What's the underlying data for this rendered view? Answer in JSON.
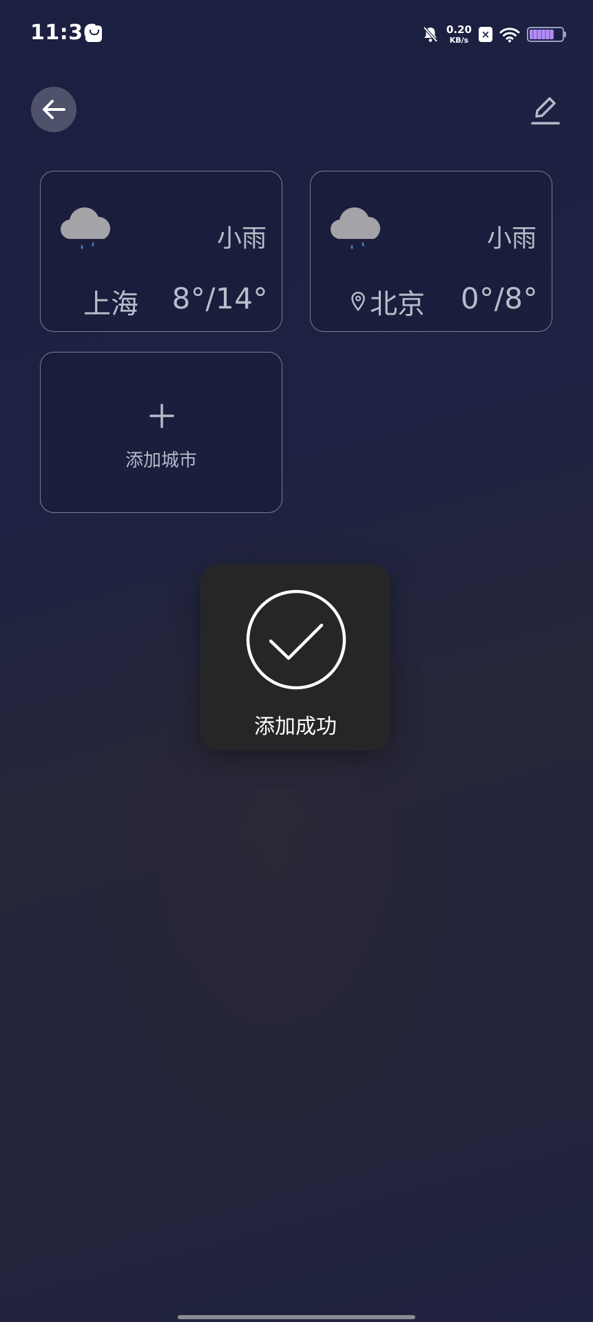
{
  "status_bar": {
    "time": "11:36",
    "net_speed_value": "0.20",
    "net_speed_unit": "KB/s",
    "sim_label": "×",
    "battery_level": 0.75
  },
  "cities": [
    {
      "name": "上海",
      "weather": "小雨",
      "temps": "8°/14°",
      "located": false
    },
    {
      "name": "北京",
      "weather": "小雨",
      "temps": "0°/8°",
      "located": true
    }
  ],
  "add_city": {
    "label": "添加城市"
  },
  "toast": {
    "message": "添加成功"
  },
  "colors": {
    "background": "#1e2242",
    "card_border": "#c8ccdc",
    "toast_bg": "#262629",
    "rain_drop": "#4a7fc0"
  }
}
